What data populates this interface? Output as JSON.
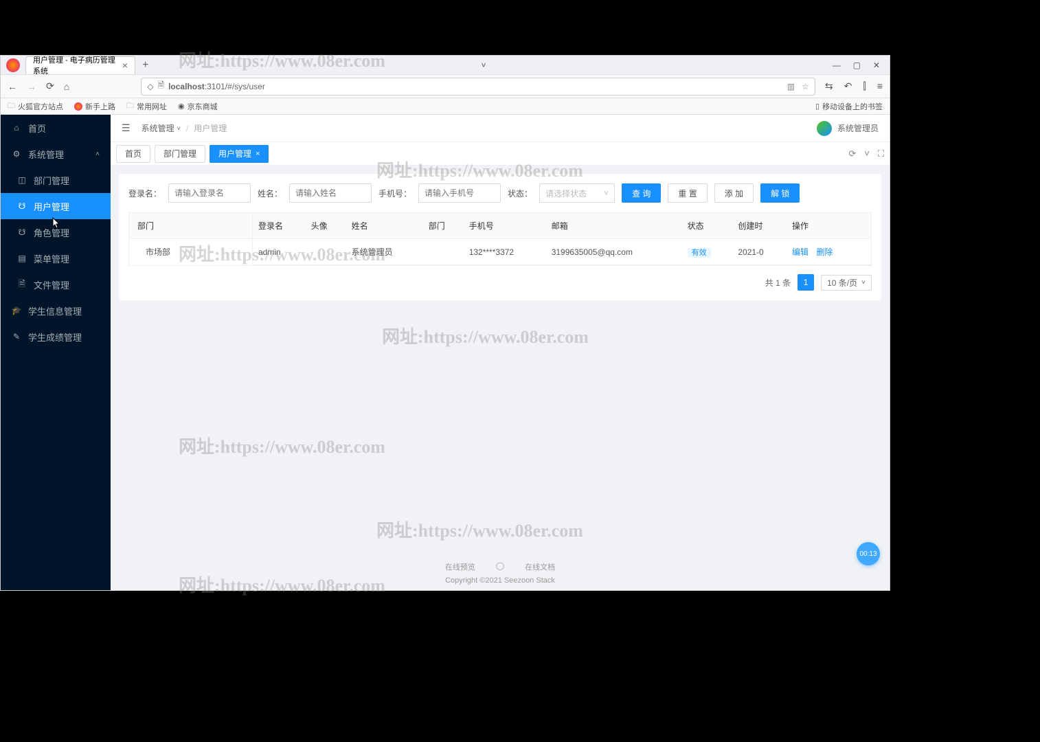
{
  "browser": {
    "tab_title": "用户管理 - 电子病历管理系统",
    "url_host": "localhost",
    "url_port_path": ":3101/#/sys/user",
    "bookmarks": [
      "火狐官方站点",
      "新手上路",
      "常用网址",
      "京东商城"
    ],
    "mobile_bookmarks": "移动设备上的书签"
  },
  "sidebar": {
    "items": [
      {
        "icon": "⌂",
        "label": "首页"
      },
      {
        "icon": "⚙",
        "label": "系统管理",
        "chev": "˄",
        "sub": [
          {
            "icon": "◫",
            "label": "部门管理"
          },
          {
            "icon": "☋",
            "label": "用户管理",
            "active": true
          },
          {
            "icon": "☋",
            "label": "角色管理"
          },
          {
            "icon": "▤",
            "label": "菜单管理"
          },
          {
            "icon": "🗎",
            "label": "文件管理"
          }
        ]
      },
      {
        "icon": "🎓",
        "label": "学生信息管理"
      },
      {
        "icon": "✎",
        "label": "学生成绩管理"
      }
    ]
  },
  "header": {
    "crumb1": "系统管理",
    "crumb2": "用户管理",
    "user": "系统管理员"
  },
  "tabs": [
    {
      "label": "首页"
    },
    {
      "label": "部门管理"
    },
    {
      "label": "用户管理",
      "active": true,
      "closable": true
    }
  ],
  "search": {
    "login_label": "登录名：",
    "login_ph": "请输入登录名",
    "name_label": "姓名：",
    "name_ph": "请输入姓名",
    "phone_label": "手机号：",
    "phone_ph": "请输入手机号",
    "status_label": "状态：",
    "status_ph": "请选择状态",
    "btn_query": "查 询",
    "btn_reset": "重 置",
    "btn_add": "添 加",
    "btn_unlock": "解 锁"
  },
  "tree": {
    "header": "部门",
    "node": "市场部"
  },
  "table": {
    "cols": [
      "登录名",
      "头像",
      "姓名",
      "部门",
      "手机号",
      "邮箱",
      "状态",
      "创建时",
      "操作"
    ],
    "row": {
      "login": "admin",
      "name": "系统管理员",
      "phone": "132****3372",
      "email": "3199635005@qq.com",
      "status": "有效",
      "created": "2021-0",
      "edit": "编辑",
      "del": "删除"
    }
  },
  "pagination": {
    "total": "共 1 条",
    "page": "1",
    "size": "10 条/页"
  },
  "footer": {
    "link1": "在线预览",
    "link2": "在线文档",
    "copy": "Copyright ©2021 Seezoon Stack"
  },
  "timer": "00:13",
  "watermark": "网址:https://www.08er.com"
}
